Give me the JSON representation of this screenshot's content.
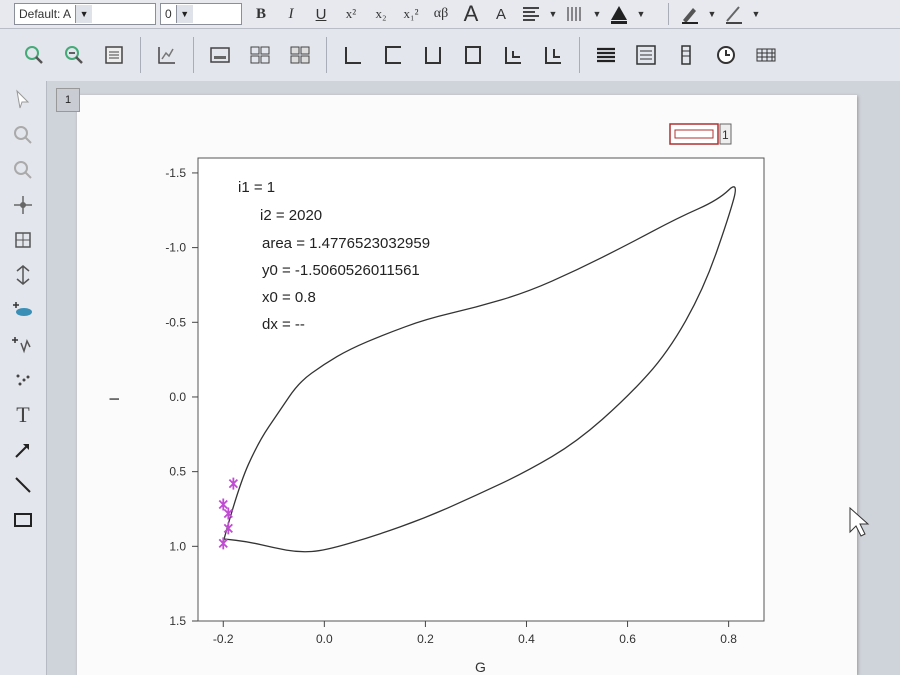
{
  "toolbar1": {
    "font_name": "Default: A",
    "font_size": "0",
    "bold": "B",
    "italic": "I",
    "underline": "U",
    "superscript": "x²",
    "subscript": "x₂",
    "supsub": "x₁²",
    "greek": "αβ",
    "grow_font": "A",
    "shrink_font": "A"
  },
  "plot": {
    "xlabel": "G",
    "ylabel": "I"
  },
  "annotation": {
    "i1": "i1 = 1",
    "i2": "i2 = 2020",
    "area": "area = 1.4776523032959",
    "y0": "y0 = -1.5060526011561",
    "x0": "x0 = 0.8",
    "dx": "dx = --"
  },
  "layer_label": "1",
  "chart_data": {
    "type": "line",
    "xlabel": "G",
    "ylabel": "I",
    "xlim": [
      -0.25,
      0.87
    ],
    "ylim": [
      1.5,
      -1.6
    ],
    "y_inverted": true,
    "xticks": [
      -0.2,
      0.0,
      0.2,
      0.4,
      0.6,
      0.8
    ],
    "xtick_labels": [
      "-0.2",
      "0.0",
      "0.2",
      "0.4",
      "0.6",
      "0.8"
    ],
    "yticks": [
      -1.5,
      -1.0,
      -0.5,
      0.0,
      0.5,
      1.0,
      1.5
    ],
    "ytick_labels": [
      "-1.5",
      "-1.0",
      "-0.5",
      "0.0",
      "0.5",
      "1.0",
      "1.5"
    ],
    "series": [
      {
        "color": "#333333",
        "x": [
          -0.2,
          -0.17,
          -0.13,
          -0.09,
          -0.05,
          0.0,
          0.05,
          0.12,
          0.2,
          0.3,
          0.4,
          0.5,
          0.6,
          0.7,
          0.78,
          0.82,
          0.8,
          0.75,
          0.68,
          0.6,
          0.5,
          0.4,
          0.3,
          0.2,
          0.1,
          0.0,
          -0.05,
          -0.1,
          -0.15,
          -0.2
        ],
        "y": [
          0.97,
          0.6,
          0.3,
          0.1,
          -0.1,
          -0.22,
          -0.32,
          -0.42,
          -0.52,
          -0.6,
          -0.7,
          -0.85,
          -1.02,
          -1.2,
          -1.32,
          -1.45,
          -1.2,
          -0.72,
          -0.3,
          0.0,
          0.3,
          0.5,
          0.66,
          0.81,
          0.93,
          1.03,
          1.04,
          1.01,
          0.97,
          0.95
        ]
      }
    ],
    "markers": {
      "color": "#c24bd4",
      "x": [
        -0.2,
        -0.19,
        -0.18,
        -0.2,
        -0.19
      ],
      "y": [
        0.98,
        0.78,
        0.58,
        0.72,
        0.88
      ]
    }
  }
}
